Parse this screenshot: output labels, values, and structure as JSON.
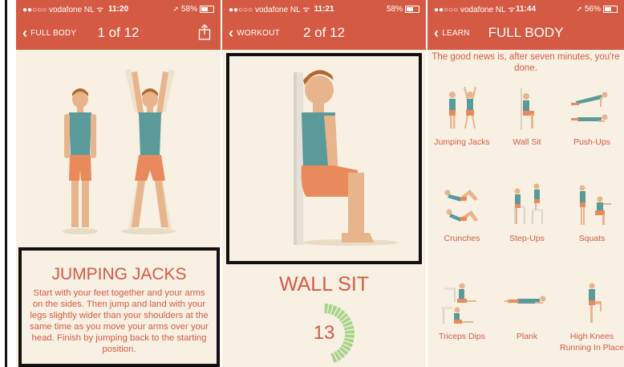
{
  "colors": {
    "accent": "#d55a44",
    "background": "#f7f0e3",
    "timer_green": "#a8d48a"
  },
  "screen1": {
    "status": {
      "carrier": "●●○○○ vodafone NL ᯤ",
      "time": "11:20",
      "battery": "58%"
    },
    "back_label": "FULL BODY",
    "title": "1 of 12",
    "exercise_title": "JUMPING JACKS",
    "description": "Start with your feet together and your arms on the sides. Then jump and land with your legs slightly wider than your shoulders at the same time as you move your arms over your head. Finish by jumping back to the starting position."
  },
  "screen2": {
    "status": {
      "carrier": "●●○○○ vodafone NL ᯤ",
      "time": "11:21",
      "battery": "58%"
    },
    "back_label": "WORKOUT",
    "title": "2 of 12",
    "exercise_title": "WALL SIT",
    "timer_value": "13",
    "timer_progress": 0.45
  },
  "screen3": {
    "status": {
      "carrier": "●●○○○ vodafone NL ᯤ",
      "time": "11:44",
      "battery": "56%"
    },
    "back_label": "LEARN",
    "title": "FULL BODY",
    "intro": "The good news is, after seven minutes, you're done.",
    "exercises": [
      "Jumping Jacks",
      "Wall Sit",
      "Push-Ups",
      "Crunches",
      "Step-Ups",
      "Squats",
      "Triceps Dips",
      "Plank",
      "High Knees Running In Place"
    ]
  }
}
